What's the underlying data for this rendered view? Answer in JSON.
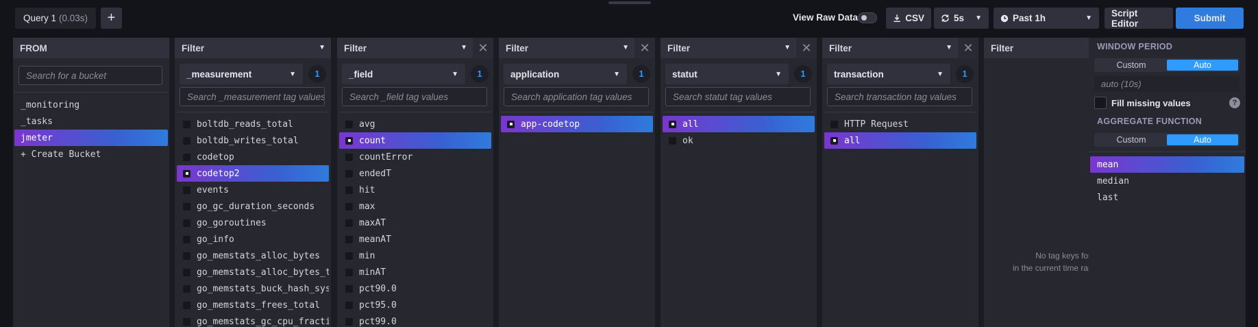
{
  "query_tab": {
    "name": "Query 1",
    "time": "(0.03s)"
  },
  "toolbar": {
    "view_raw_label": "View Raw Data",
    "csv_label": "CSV",
    "refresh_label": "5s",
    "time_range_label": "Past 1h",
    "script_editor_label": "Script Editor",
    "submit_label": "Submit"
  },
  "from": {
    "title": "FROM",
    "search_placeholder": "Search for a bucket",
    "buckets": [
      "_monitoring",
      "_tasks",
      "jmeter"
    ],
    "selected": "jmeter",
    "create_label": "+ Create Bucket"
  },
  "filters": [
    {
      "title": "Filter",
      "key": "_measurement",
      "count": "1",
      "search_placeholder": "Search _measurement tag values",
      "values": [
        "boltdb_reads_total",
        "boltdb_writes_total",
        "codetop",
        "codetop2",
        "events",
        "go_gc_duration_seconds",
        "go_goroutines",
        "go_info",
        "go_memstats_alloc_bytes",
        "go_memstats_alloc_bytes_total",
        "go_memstats_buck_hash_sys_bytes",
        "go_memstats_frees_total",
        "go_memstats_gc_cpu_fraction"
      ],
      "selected": [
        "codetop2"
      ]
    },
    {
      "title": "Filter",
      "key": "_field",
      "count": "1",
      "search_placeholder": "Search _field tag values",
      "values": [
        "avg",
        "count",
        "countError",
        "endedT",
        "hit",
        "max",
        "maxAT",
        "meanAT",
        "min",
        "minAT",
        "pct90.0",
        "pct95.0",
        "pct99.0"
      ],
      "selected": [
        "count"
      ]
    },
    {
      "title": "Filter",
      "key": "application",
      "count": "1",
      "search_placeholder": "Search application tag values",
      "values": [
        "app-codetop"
      ],
      "selected": [
        "app-codetop"
      ]
    },
    {
      "title": "Filter",
      "key": "statut",
      "count": "1",
      "search_placeholder": "Search statut tag values",
      "values": [
        "all",
        "ok"
      ],
      "selected": [
        "all"
      ]
    },
    {
      "title": "Filter",
      "key": "transaction",
      "count": "1",
      "search_placeholder": "Search transaction tag values",
      "values": [
        "HTTP Request",
        "all"
      ],
      "selected": [
        "all"
      ]
    }
  ],
  "last_filter": {
    "title": "Filter",
    "empty_line1": "No tag keys found",
    "empty_line2": "in the current time range"
  },
  "aggregate": {
    "window_title": "WINDOW PERIOD",
    "custom_label": "Custom",
    "auto_label": "Auto",
    "period_value": "auto (10s)",
    "fill_label": "Fill missing values",
    "help_label": "?",
    "function_title": "AGGREGATE FUNCTION",
    "functions": [
      "mean",
      "median",
      "last"
    ],
    "selected_function": "mean"
  }
}
